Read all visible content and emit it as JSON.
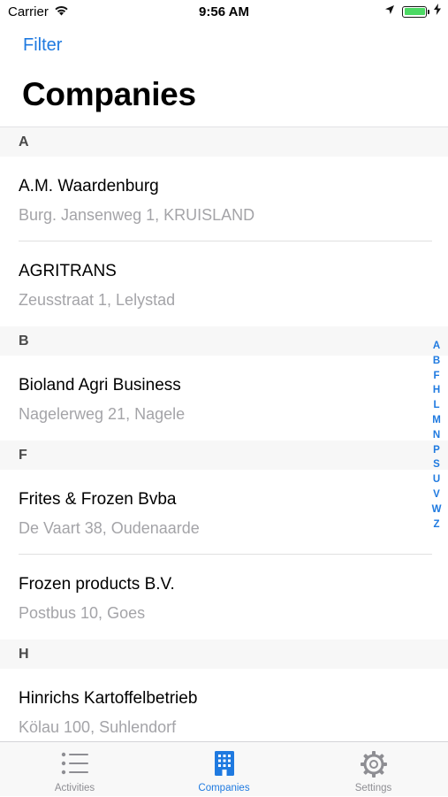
{
  "status_bar": {
    "carrier": "Carrier",
    "time": "9:56 AM",
    "battery_color": "#4cd964"
  },
  "nav": {
    "filter_label": "Filter",
    "title": "Companies"
  },
  "sections": [
    {
      "letter": "A",
      "rows": [
        {
          "name": "A.M. Waardenburg",
          "address": "Burg. Jansenweg 1, KRUISLAND"
        },
        {
          "name": "AGRITRANS",
          "address": "Zeusstraat 1, Lelystad"
        }
      ]
    },
    {
      "letter": "B",
      "rows": [
        {
          "name": "Bioland Agri Business",
          "address": "Nagelerweg 21, Nagele"
        }
      ]
    },
    {
      "letter": "F",
      "rows": [
        {
          "name": "Frites & Frozen Bvba",
          "address": "De Vaart 38, Oudenaarde"
        },
        {
          "name": "Frozen products B.V.",
          "address": "Postbus 10, Goes"
        }
      ]
    },
    {
      "letter": "H",
      "rows": [
        {
          "name": "Hinrichs Kartoffelbetrieb",
          "address": "Kölau 100, Suhlendorf"
        }
      ]
    }
  ],
  "index_letters": [
    "A",
    "B",
    "F",
    "H",
    "L",
    "M",
    "N",
    "P",
    "S",
    "U",
    "V",
    "W",
    "Z"
  ],
  "tabs": [
    {
      "label": "Activities",
      "icon": "list-icon",
      "active": false
    },
    {
      "label": "Companies",
      "icon": "building-icon",
      "active": true
    },
    {
      "label": "Settings",
      "icon": "gear-icon",
      "active": false
    }
  ],
  "colors": {
    "accent": "#1f7ae0",
    "secondary_text": "#a4a4a8",
    "section_bg": "#f7f7f7"
  }
}
